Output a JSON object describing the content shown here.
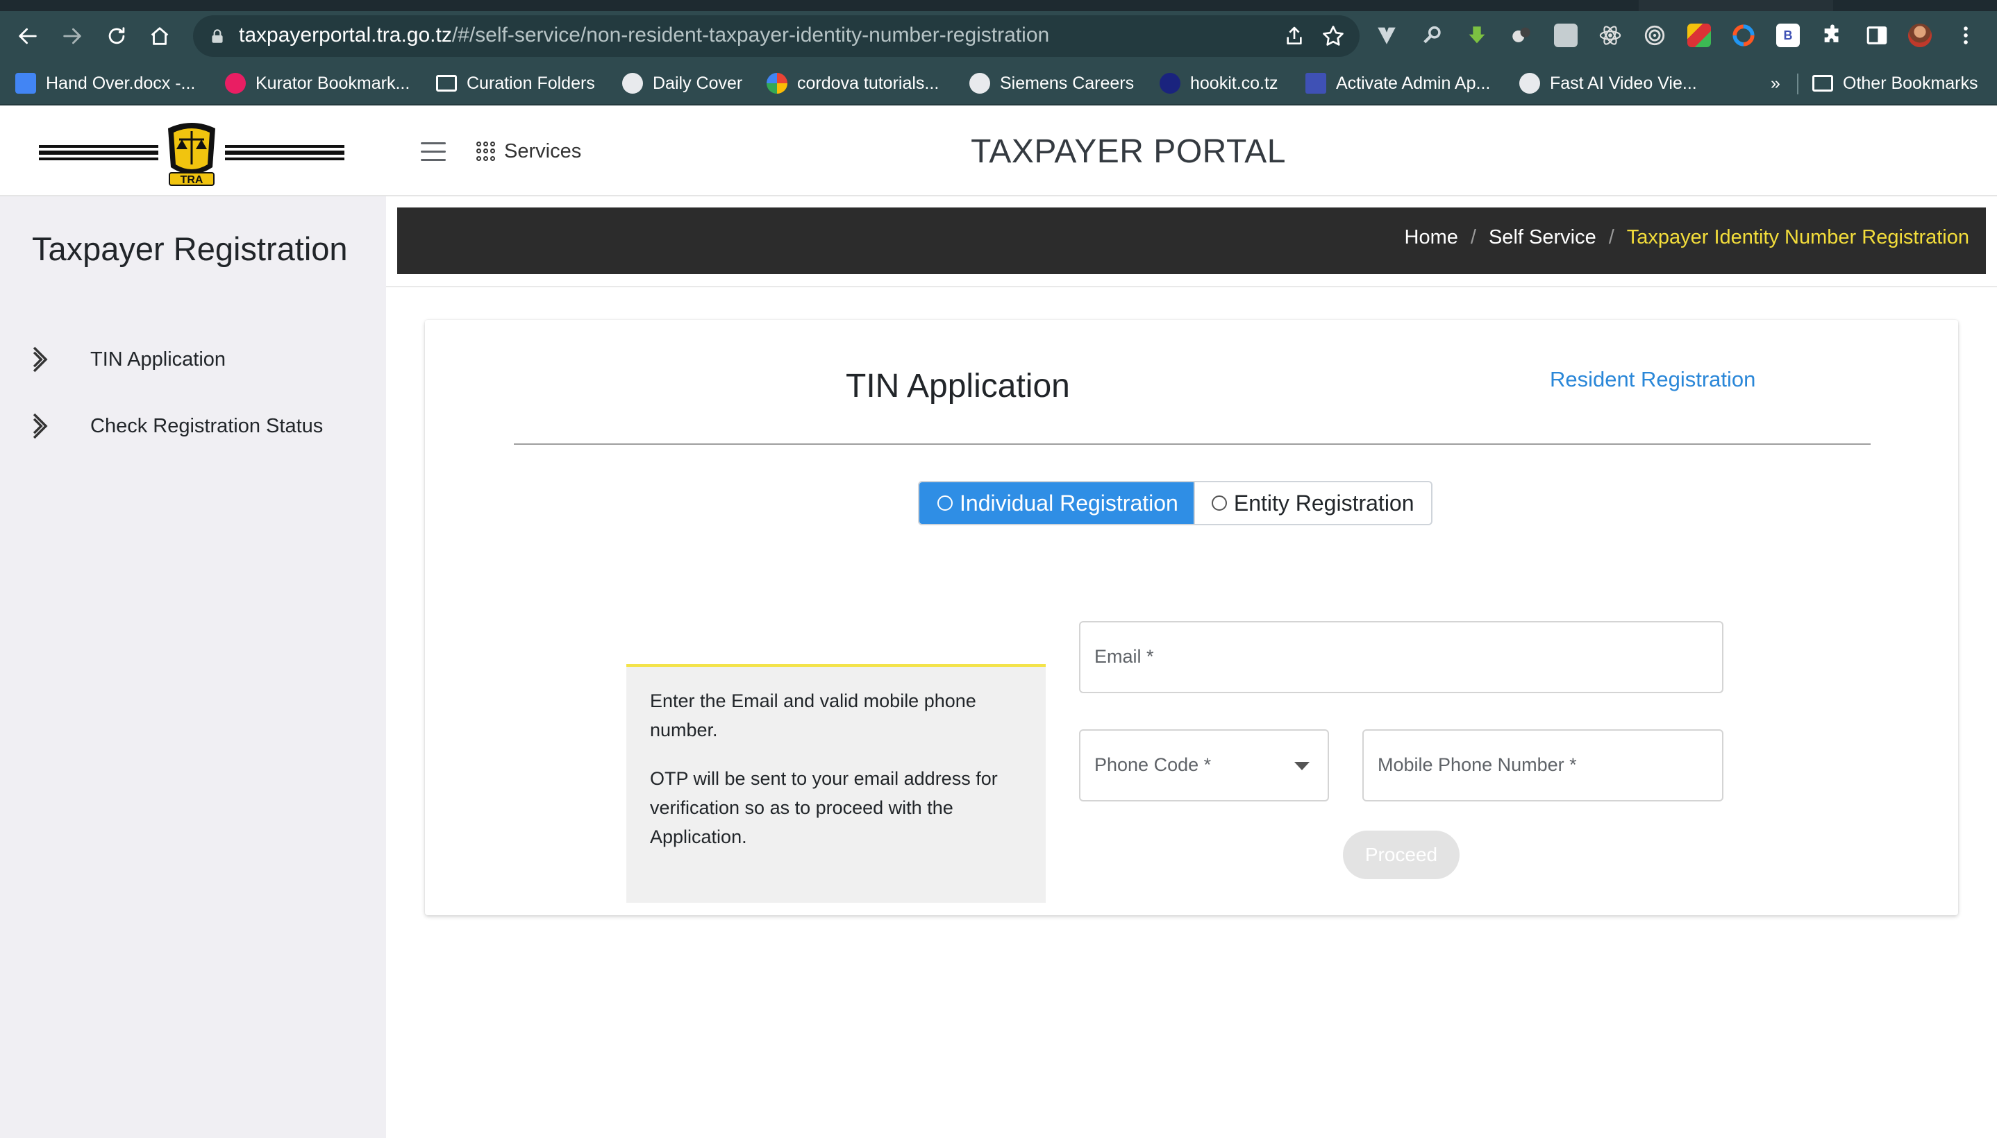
{
  "browser": {
    "url_host": "taxpayerportal.tra.go.tz",
    "url_path": "/#/self-service/non-resident-taxpayer-identity-number-registration",
    "bookmarks": [
      {
        "label": "Hand Over.docx -..."
      },
      {
        "label": "Kurator Bookmark..."
      },
      {
        "label": "Curation Folders"
      },
      {
        "label": "Daily Cover"
      },
      {
        "label": "cordova tutorials..."
      },
      {
        "label": "Siemens Careers"
      },
      {
        "label": "hookit.co.tz"
      },
      {
        "label": "Activate Admin Ap..."
      },
      {
        "label": "Fast AI Video Vie..."
      }
    ],
    "overflow_label": "»",
    "other_bookmarks": "Other Bookmarks"
  },
  "header": {
    "logo_text": "TRA",
    "services_label": "Services",
    "portal_title": "TAXPAYER PORTAL"
  },
  "sidebar": {
    "title": "Taxpayer Registration",
    "items": [
      {
        "label": "TIN Application"
      },
      {
        "label": "Check Registration Status"
      }
    ]
  },
  "breadcrumb": {
    "items": [
      "Home",
      "Self Service"
    ],
    "separator": "/",
    "active": "Taxpayer Identity Number Registration",
    "active_color": "#f3dd3b"
  },
  "form": {
    "title": "TIN Application",
    "resident_link": "Resident Registration",
    "toggle": {
      "individual": "Individual Registration",
      "entity": "Entity Registration",
      "selected": "Individual Registration"
    },
    "info": {
      "line1": "Enter the Email and valid mobile phone number.",
      "line2": "OTP will be sent to your email address for verification so as to proceed with the Application."
    },
    "email_label": "Email *",
    "phone_code_label": "Phone Code *",
    "mobile_label": "Mobile Phone Number *",
    "proceed_label": "Proceed"
  },
  "colors": {
    "accent": "#2f8ee5",
    "link": "#2a87d8",
    "breadcrumb_bg": "#2c2c2c",
    "sidebar_bg": "#f0eff3",
    "chrome_bg": "#2f4a4f"
  }
}
